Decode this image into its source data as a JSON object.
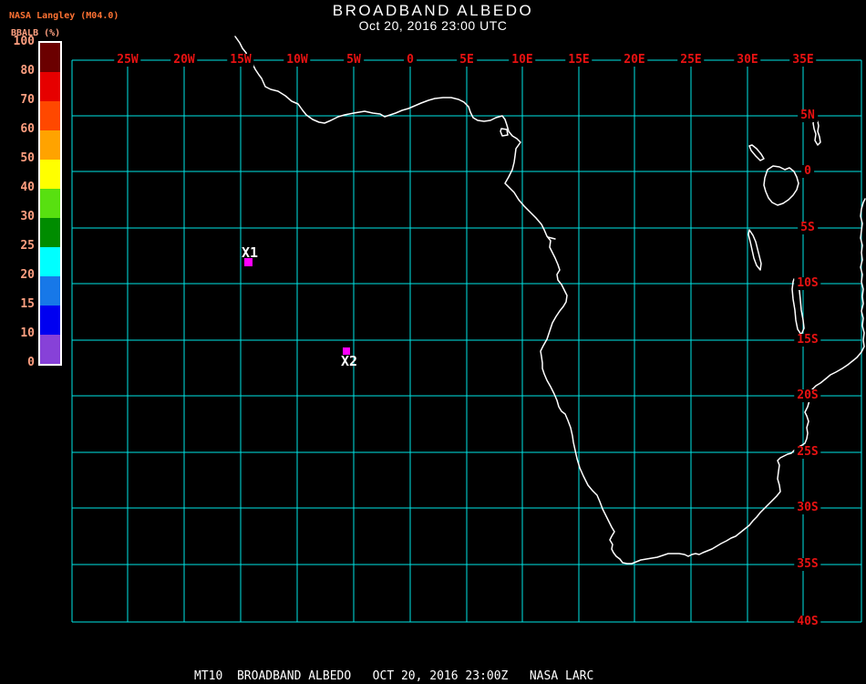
{
  "header": {
    "title": "BROADBAND ALBEDO",
    "subtitle": "Oct 20, 2016 23:00 UTC",
    "source": "NASA Langley (M04.0)",
    "units_label": "BBALB (%)"
  },
  "colorbar": {
    "ticks": [
      "100",
      "80",
      "70",
      "60",
      "50",
      "40",
      "30",
      "25",
      "20",
      "15",
      "10",
      "0"
    ],
    "segment_colors": [
      "#6B0000",
      "#E60000",
      "#FF4800",
      "#FFA300",
      "#FFFF00",
      "#58E010",
      "#008C00",
      "#00FFFF",
      "#1778E8",
      "#0000F0",
      "#8741D8"
    ],
    "tick_color": "#FF9F80"
  },
  "map": {
    "grid_color": "#00E6E6",
    "coord_label_color": "#E81212",
    "coast_color": "#FFFFFF",
    "marker_color": "#FF00FF",
    "lon_labels": [
      "25W",
      "20W",
      "15W",
      "10W",
      "5W",
      "0",
      "5E",
      "10E",
      "15E",
      "20E",
      "25E",
      "30E",
      "35E"
    ],
    "lat_labels": [
      "5N",
      "0",
      "5S",
      "10S",
      "15S",
      "20S",
      "25S",
      "30S",
      "35S",
      "40S"
    ],
    "markers": [
      {
        "label": "X1"
      },
      {
        "label": "X2"
      }
    ]
  },
  "footer": {
    "text": "MT10  BROADBAND ALBEDO   OCT 20, 2016 23:00Z   NASA LARC"
  }
}
